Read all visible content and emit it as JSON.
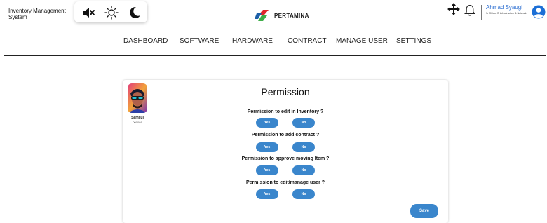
{
  "header": {
    "app_title": "Inventory Management System",
    "brand_name": "PERTAMINA",
    "theme_icons": [
      "mute-icon",
      "sun-icon",
      "moon-icon"
    ]
  },
  "user": {
    "name": "Ahmad Syaugi",
    "role": "Sr Officer IT Infrastructure & Network"
  },
  "nav": {
    "items": [
      "DASHBOARD",
      "SOFTWARE",
      "HARDWARE",
      "CONTRACT",
      "MANAGE USER",
      "SETTINGS"
    ]
  },
  "permission": {
    "title": "Permission",
    "member_name": "Samsul",
    "member_id": "000001",
    "yes_label": "Yes",
    "no_label": "No",
    "questions": [
      "Permission to edit in Inventory ?",
      "Permission to add contract ?",
      "Permission to approve moving Item ?",
      "Permission to edit/manage user ?"
    ],
    "save_label": "Save"
  },
  "colors": {
    "accent": "#3a86cc",
    "user_name": "#2d6fd1",
    "brand_red": "#e3262b",
    "brand_green": "#3fae49",
    "brand_blue": "#1c5fa8"
  }
}
